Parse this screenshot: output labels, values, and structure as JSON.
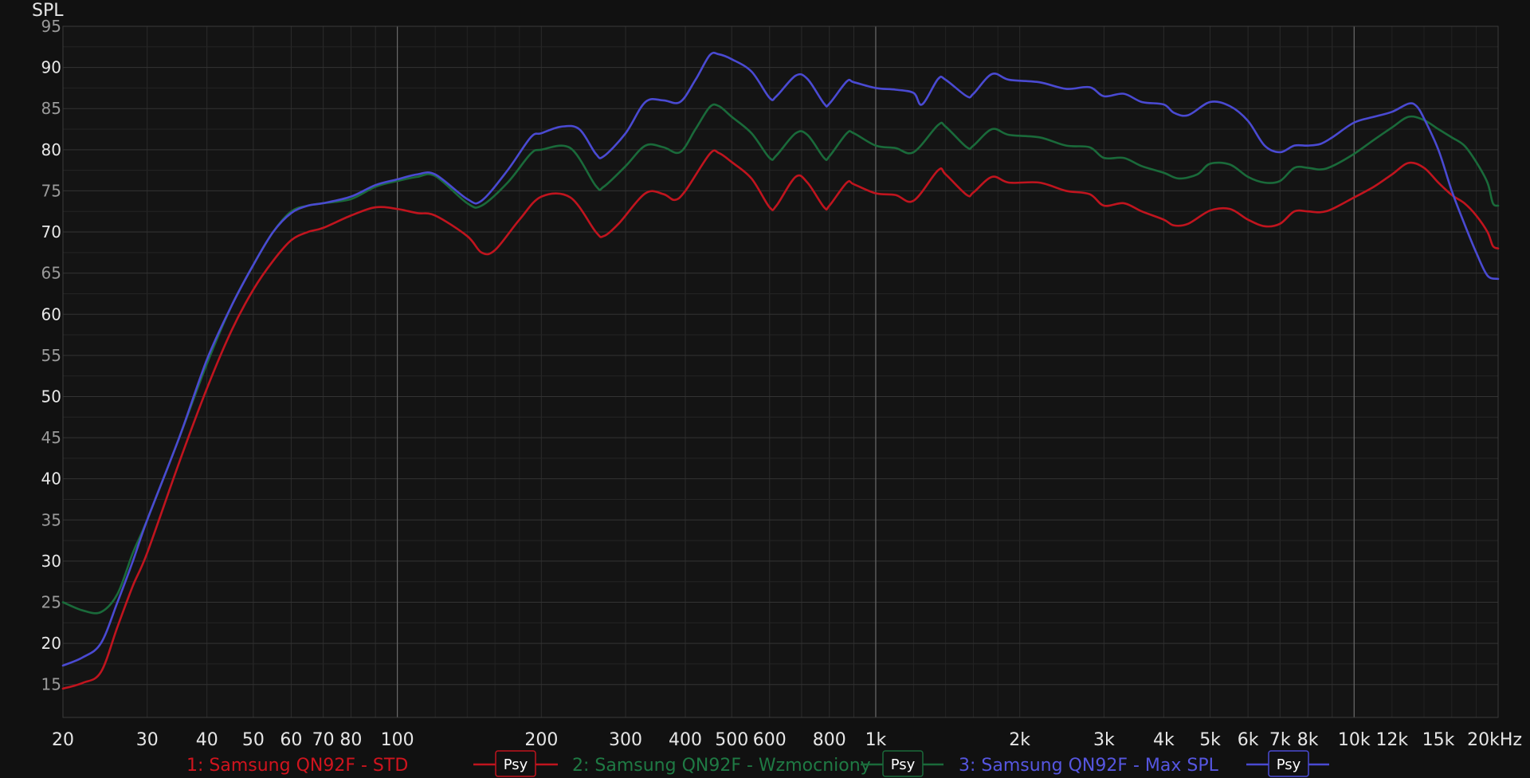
{
  "chart_data": {
    "type": "line",
    "ylabel": "SPL",
    "xlabel": "",
    "x_scale": "log",
    "xlim": [
      20,
      20000
    ],
    "ylim": [
      11,
      95
    ],
    "y_ticks": [
      15,
      20,
      25,
      30,
      35,
      40,
      45,
      50,
      55,
      60,
      65,
      70,
      75,
      80,
      85,
      90,
      95
    ],
    "x_ticks": [
      {
        "value": 20,
        "label": "20",
        "major": false
      },
      {
        "value": 30,
        "label": "30",
        "major": false
      },
      {
        "value": 40,
        "label": "40",
        "major": false
      },
      {
        "value": 50,
        "label": "50",
        "major": false
      },
      {
        "value": 60,
        "label": "60",
        "major": false
      },
      {
        "value": 70,
        "label": "70",
        "major": false
      },
      {
        "value": 80,
        "label": "80",
        "major": false
      },
      {
        "value": 100,
        "label": "100",
        "major": true
      },
      {
        "value": 200,
        "label": "200",
        "major": false
      },
      {
        "value": 300,
        "label": "300",
        "major": false
      },
      {
        "value": 400,
        "label": "400",
        "major": false
      },
      {
        "value": 500,
        "label": "500",
        "major": false
      },
      {
        "value": 600,
        "label": "600",
        "major": false
      },
      {
        "value": 800,
        "label": "800",
        "major": false
      },
      {
        "value": 1000,
        "label": "1k",
        "major": true
      },
      {
        "value": 2000,
        "label": "2k",
        "major": false
      },
      {
        "value": 3000,
        "label": "3k",
        "major": false
      },
      {
        "value": 4000,
        "label": "4k",
        "major": false
      },
      {
        "value": 5000,
        "label": "5k",
        "major": false
      },
      {
        "value": 6000,
        "label": "6k",
        "major": false
      },
      {
        "value": 7000,
        "label": "7k",
        "major": false
      },
      {
        "value": 8000,
        "label": "8k",
        "major": false
      },
      {
        "value": 10000,
        "label": "10k",
        "major": true
      },
      {
        "value": 12000,
        "label": "12k",
        "major": false,
        "dim": true
      },
      {
        "value": 15000,
        "label": "15k",
        "major": false,
        "dim": true
      },
      {
        "value": 20000,
        "label": "20kHz",
        "major": false
      }
    ],
    "grid": true,
    "legend_position": "bottom",
    "series": [
      {
        "name": "1: Samsung QN92F - STD",
        "color": "#c0141e",
        "psy_label": "Psy",
        "points": [
          [
            20,
            14.5
          ],
          [
            22,
            15.2
          ],
          [
            24,
            16.5
          ],
          [
            26,
            22
          ],
          [
            28,
            27
          ],
          [
            30,
            31
          ],
          [
            35,
            42
          ],
          [
            40,
            51
          ],
          [
            45,
            58
          ],
          [
            50,
            63
          ],
          [
            55,
            66.5
          ],
          [
            60,
            69
          ],
          [
            65,
            70
          ],
          [
            70,
            70.5
          ],
          [
            80,
            72
          ],
          [
            90,
            73
          ],
          [
            100,
            72.8
          ],
          [
            110,
            72.3
          ],
          [
            120,
            72
          ],
          [
            140,
            69.5
          ],
          [
            150,
            67.5
          ],
          [
            160,
            67.8
          ],
          [
            180,
            71.5
          ],
          [
            200,
            74.3
          ],
          [
            230,
            74.2
          ],
          [
            260,
            70
          ],
          [
            270,
            69.5
          ],
          [
            290,
            71
          ],
          [
            330,
            74.7
          ],
          [
            360,
            74.6
          ],
          [
            380,
            73.9
          ],
          [
            400,
            75
          ],
          [
            450,
            79.5
          ],
          [
            470,
            79.6
          ],
          [
            500,
            78.5
          ],
          [
            550,
            76.5
          ],
          [
            600,
            73
          ],
          [
            620,
            73.2
          ],
          [
            680,
            76.7
          ],
          [
            720,
            76
          ],
          [
            780,
            73
          ],
          [
            800,
            73.2
          ],
          [
            870,
            76
          ],
          [
            900,
            75.8
          ],
          [
            1000,
            74.7
          ],
          [
            1100,
            74.5
          ],
          [
            1200,
            73.8
          ],
          [
            1350,
            77.5
          ],
          [
            1400,
            77
          ],
          [
            1550,
            74.5
          ],
          [
            1600,
            74.8
          ],
          [
            1750,
            76.7
          ],
          [
            1900,
            76
          ],
          [
            2200,
            76
          ],
          [
            2500,
            75
          ],
          [
            2800,
            74.6
          ],
          [
            3000,
            73.2
          ],
          [
            3300,
            73.5
          ],
          [
            3600,
            72.5
          ],
          [
            4000,
            71.5
          ],
          [
            4200,
            70.8
          ],
          [
            4500,
            71
          ],
          [
            5000,
            72.6
          ],
          [
            5500,
            72.8
          ],
          [
            6000,
            71.5
          ],
          [
            6500,
            70.7
          ],
          [
            7000,
            71
          ],
          [
            7500,
            72.5
          ],
          [
            8000,
            72.5
          ],
          [
            8500,
            72.4
          ],
          [
            9000,
            72.8
          ],
          [
            10000,
            74.2
          ],
          [
            11000,
            75.5
          ],
          [
            12000,
            77
          ],
          [
            13000,
            78.4
          ],
          [
            14000,
            77.8
          ],
          [
            15000,
            76
          ],
          [
            16000,
            74.5
          ],
          [
            17000,
            73.5
          ],
          [
            18000,
            72
          ],
          [
            19000,
            70
          ],
          [
            19500,
            68.3
          ],
          [
            20000,
            68
          ]
        ]
      },
      {
        "name": "2: Samsung QN92F - Wzmocniony",
        "color": "#1a6a3a",
        "psy_label": "Psy",
        "points": [
          [
            20,
            25
          ],
          [
            22,
            24
          ],
          [
            24,
            23.8
          ],
          [
            26,
            26
          ],
          [
            28,
            31
          ],
          [
            30,
            35
          ],
          [
            35,
            45
          ],
          [
            40,
            54
          ],
          [
            45,
            61
          ],
          [
            50,
            66
          ],
          [
            55,
            70
          ],
          [
            60,
            72.5
          ],
          [
            65,
            73.2
          ],
          [
            70,
            73.5
          ],
          [
            80,
            74
          ],
          [
            90,
            75.5
          ],
          [
            100,
            76.2
          ],
          [
            110,
            76.7
          ],
          [
            120,
            76.8
          ],
          [
            140,
            73.5
          ],
          [
            150,
            73.2
          ],
          [
            170,
            76
          ],
          [
            190,
            79.5
          ],
          [
            200,
            80
          ],
          [
            230,
            80.2
          ],
          [
            260,
            75.6
          ],
          [
            270,
            75.5
          ],
          [
            300,
            78
          ],
          [
            330,
            80.5
          ],
          [
            360,
            80.3
          ],
          [
            390,
            79.7
          ],
          [
            420,
            82.5
          ],
          [
            450,
            85.2
          ],
          [
            470,
            85.3
          ],
          [
            500,
            84
          ],
          [
            550,
            82
          ],
          [
            600,
            79
          ],
          [
            620,
            79.3
          ],
          [
            680,
            82
          ],
          [
            720,
            81.8
          ],
          [
            780,
            79
          ],
          [
            800,
            79.2
          ],
          [
            870,
            82
          ],
          [
            900,
            82
          ],
          [
            1000,
            80.5
          ],
          [
            1100,
            80.2
          ],
          [
            1200,
            79.7
          ],
          [
            1350,
            83
          ],
          [
            1400,
            82.8
          ],
          [
            1550,
            80.3
          ],
          [
            1600,
            80.5
          ],
          [
            1750,
            82.5
          ],
          [
            1900,
            81.8
          ],
          [
            2200,
            81.5
          ],
          [
            2500,
            80.5
          ],
          [
            2800,
            80.3
          ],
          [
            3000,
            79
          ],
          [
            3300,
            79
          ],
          [
            3600,
            78
          ],
          [
            4000,
            77.2
          ],
          [
            4300,
            76.5
          ],
          [
            4700,
            77
          ],
          [
            5000,
            78.3
          ],
          [
            5500,
            78.2
          ],
          [
            6000,
            76.7
          ],
          [
            6500,
            76
          ],
          [
            7000,
            76.2
          ],
          [
            7500,
            77.8
          ],
          [
            8000,
            77.8
          ],
          [
            8500,
            77.6
          ],
          [
            9000,
            78
          ],
          [
            10000,
            79.5
          ],
          [
            11000,
            81.2
          ],
          [
            12000,
            82.7
          ],
          [
            13000,
            84
          ],
          [
            14000,
            83.6
          ],
          [
            15000,
            82.5
          ],
          [
            16000,
            81.5
          ],
          [
            17000,
            80.5
          ],
          [
            18000,
            78.5
          ],
          [
            19000,
            76
          ],
          [
            19500,
            73.5
          ],
          [
            20000,
            73.2
          ]
        ]
      },
      {
        "name": "3: Samsung QN92F - Max SPL",
        "color": "#4a4ad2",
        "psy_label": "Psy",
        "points": [
          [
            20,
            17.3
          ],
          [
            22,
            18.3
          ],
          [
            24,
            20
          ],
          [
            26,
            25
          ],
          [
            28,
            30
          ],
          [
            30,
            35
          ],
          [
            35,
            45
          ],
          [
            40,
            54.5
          ],
          [
            45,
            61
          ],
          [
            50,
            66
          ],
          [
            55,
            70
          ],
          [
            60,
            72.3
          ],
          [
            65,
            73.2
          ],
          [
            70,
            73.5
          ],
          [
            80,
            74.3
          ],
          [
            90,
            75.7
          ],
          [
            100,
            76.4
          ],
          [
            110,
            77
          ],
          [
            120,
            77
          ],
          [
            140,
            74
          ],
          [
            150,
            73.8
          ],
          [
            170,
            77.5
          ],
          [
            190,
            81.5
          ],
          [
            200,
            82
          ],
          [
            220,
            82.8
          ],
          [
            240,
            82.5
          ],
          [
            260,
            79.5
          ],
          [
            270,
            79.2
          ],
          [
            300,
            82
          ],
          [
            330,
            85.8
          ],
          [
            360,
            86
          ],
          [
            390,
            85.8
          ],
          [
            420,
            88.5
          ],
          [
            450,
            91.5
          ],
          [
            470,
            91.6
          ],
          [
            500,
            91
          ],
          [
            550,
            89.5
          ],
          [
            600,
            86.3
          ],
          [
            620,
            86.5
          ],
          [
            680,
            89
          ],
          [
            720,
            88.6
          ],
          [
            780,
            85.6
          ],
          [
            800,
            85.6
          ],
          [
            870,
            88.3
          ],
          [
            900,
            88.2
          ],
          [
            1000,
            87.5
          ],
          [
            1100,
            87.3
          ],
          [
            1200,
            86.9
          ],
          [
            1250,
            85.5
          ],
          [
            1350,
            88.6
          ],
          [
            1400,
            88.5
          ],
          [
            1550,
            86.5
          ],
          [
            1600,
            86.8
          ],
          [
            1750,
            89.2
          ],
          [
            1900,
            88.5
          ],
          [
            2200,
            88.2
          ],
          [
            2500,
            87.4
          ],
          [
            2800,
            87.6
          ],
          [
            3000,
            86.5
          ],
          [
            3300,
            86.8
          ],
          [
            3600,
            85.8
          ],
          [
            4000,
            85.5
          ],
          [
            4200,
            84.5
          ],
          [
            4500,
            84.2
          ],
          [
            5000,
            85.8
          ],
          [
            5500,
            85.3
          ],
          [
            6000,
            83.5
          ],
          [
            6500,
            80.5
          ],
          [
            7000,
            79.7
          ],
          [
            7500,
            80.5
          ],
          [
            8000,
            80.5
          ],
          [
            8500,
            80.7
          ],
          [
            9000,
            81.5
          ],
          [
            10000,
            83.3
          ],
          [
            11000,
            84
          ],
          [
            12000,
            84.6
          ],
          [
            13000,
            85.6
          ],
          [
            13500,
            85.3
          ],
          [
            14000,
            83.8
          ],
          [
            15000,
            80
          ],
          [
            16000,
            75
          ],
          [
            17000,
            71
          ],
          [
            18000,
            67.5
          ],
          [
            19000,
            64.7
          ],
          [
            20000,
            64.3
          ]
        ]
      }
    ]
  }
}
